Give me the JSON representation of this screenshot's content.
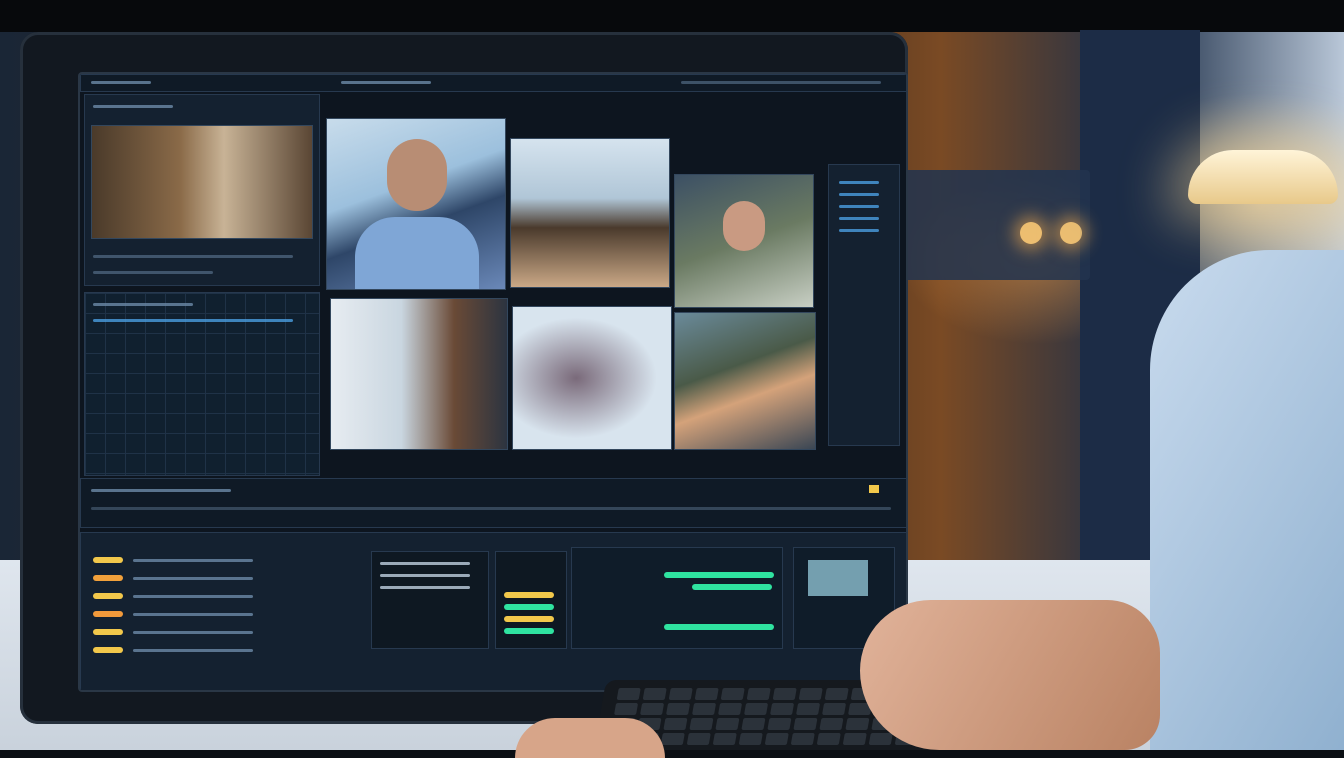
{
  "scene": {
    "description_type": "video-editing-workstation",
    "colors": {
      "screen_bg": "#0d151f",
      "panel_bg": "#142130",
      "accent_green": "#2fe3a0",
      "accent_yellow": "#f2c84b",
      "accent_blue": "#4a9ee0"
    }
  },
  "monitor": {
    "viewers": [
      {
        "id": "source-viewer",
        "content": "office-room"
      },
      {
        "id": "clip-man-portrait",
        "content": "man-in-blue-shirt"
      },
      {
        "id": "clip-window-room",
        "content": "room-with-window"
      },
      {
        "id": "clip-woman-glasses",
        "content": "woman-with-glasses"
      },
      {
        "id": "clip-interior",
        "content": "living-room"
      },
      {
        "id": "clip-abstract",
        "content": "abstract-figure"
      },
      {
        "id": "clip-workers",
        "content": "people-working"
      }
    ],
    "timeline": {
      "track_colors": [
        "#f2c84b",
        "#f2a13b",
        "#f2c84b",
        "#f29a3b",
        "#f2c84b",
        "#f2c84b"
      ],
      "green_clips": 3
    }
  }
}
